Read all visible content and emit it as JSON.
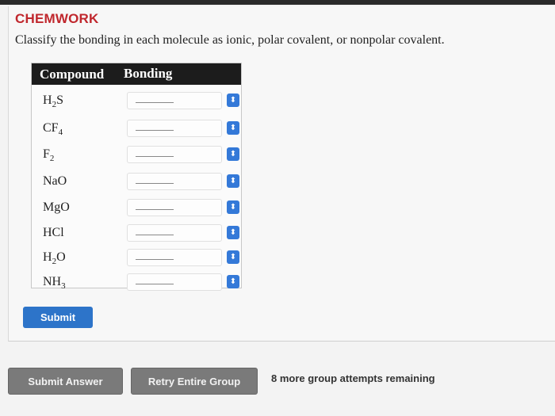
{
  "header": {
    "title": "CHEMWORK",
    "instruction": "Classify the bonding in each molecule as ionic, polar covalent, or nonpolar covalent."
  },
  "table": {
    "columns": [
      "Compound",
      "Bonding"
    ],
    "rows": [
      {
        "base": "H",
        "sub": "2",
        "tail": "S",
        "value": ""
      },
      {
        "base": "CF",
        "sub": "4",
        "tail": "",
        "value": ""
      },
      {
        "base": "F",
        "sub": "2",
        "tail": "",
        "value": ""
      },
      {
        "base": "NaO",
        "sub": "",
        "tail": "",
        "value": ""
      },
      {
        "base": "MgO",
        "sub": "",
        "tail": "",
        "value": ""
      },
      {
        "base": "HCl",
        "sub": "",
        "tail": "",
        "value": ""
      },
      {
        "base": "H",
        "sub": "2",
        "tail": "O",
        "value": ""
      },
      {
        "base": "NH",
        "sub": "3",
        "tail": "",
        "value": ""
      }
    ]
  },
  "buttons": {
    "submit": "Submit",
    "submit_answer": "Submit Answer",
    "retry_group": "Retry Entire Group"
  },
  "status": {
    "attempts_remaining": "8 more group attempts remaining"
  },
  "icons": {
    "select_arrow": "chevron-up-down-icon"
  },
  "colors": {
    "title": "#c0272d",
    "accent": "#2d74c9",
    "disabled_button": "#7a7a7a"
  }
}
